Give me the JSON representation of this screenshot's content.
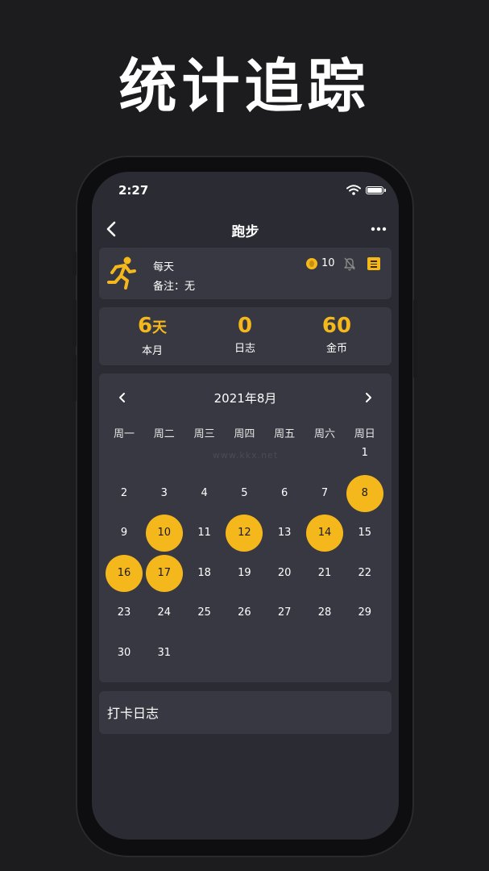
{
  "promo": {
    "title": "统计追踪"
  },
  "status": {
    "time": "2:27"
  },
  "nav": {
    "title": "跑步"
  },
  "habit": {
    "frequency": "每天",
    "note": "备注：无",
    "coins": "10",
    "icon": "running-person-icon",
    "accent": "#f5b81c"
  },
  "stats": [
    {
      "value": "6",
      "unit": "天",
      "label": "本月"
    },
    {
      "value": "0",
      "unit": "",
      "label": "日志"
    },
    {
      "value": "60",
      "unit": "",
      "label": "金币"
    }
  ],
  "calendar": {
    "month_label": "2021年8月",
    "weekdays": [
      "周一",
      "周二",
      "周三",
      "周四",
      "周五",
      "周六",
      "周日"
    ],
    "first_weekday_index": 6,
    "days_in_month": 31,
    "checked_days": [
      8,
      10,
      12,
      14,
      16,
      17
    ]
  },
  "watermark": "www.kkx.net",
  "log": {
    "title": "打卡日志"
  },
  "colors": {
    "background": "#1c1c1e",
    "screen": "#2b2c33",
    "card": "#373841",
    "accent": "#f5b81c"
  }
}
